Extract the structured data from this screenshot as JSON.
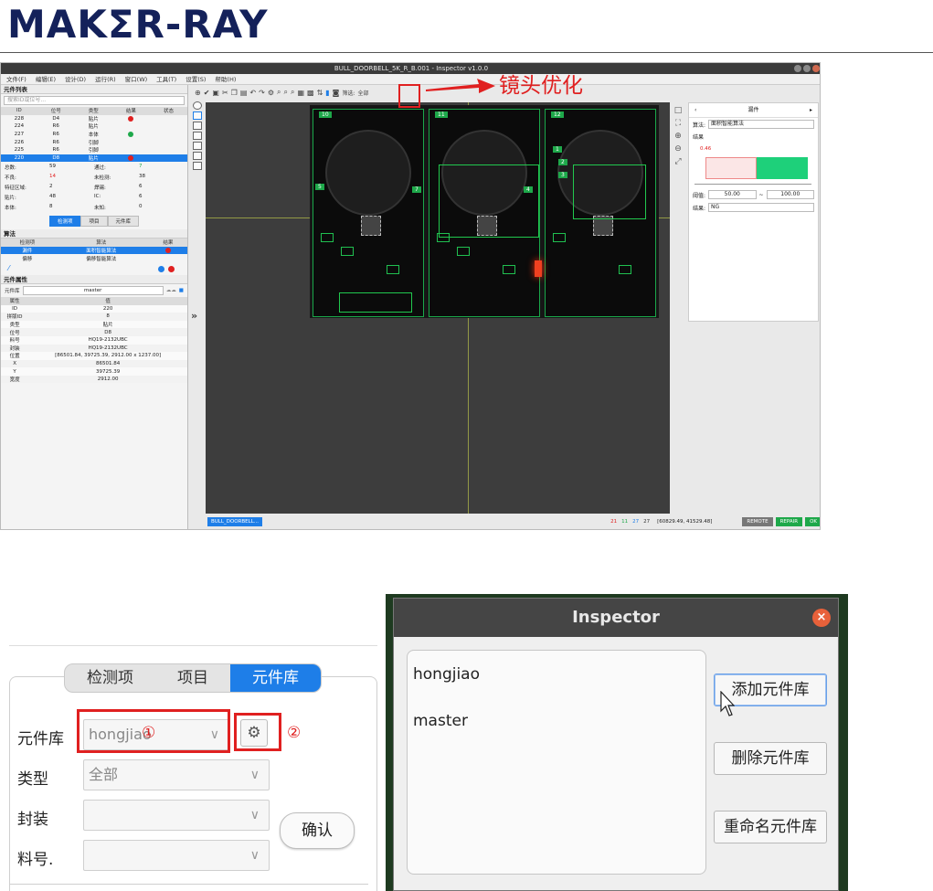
{
  "brand": {
    "logo_text": "MAKΣR-RAY"
  },
  "app": {
    "window_title": "BULL_DOORBELL_5K_R_B.001 - Inspector v1.0.0",
    "menu": [
      "文件(F)",
      "编辑(E)",
      "设计(D)",
      "运行(R)",
      "窗口(W)",
      "工具(T)",
      "设置(S)",
      "帮助(H)"
    ],
    "left_panel": {
      "title": "元件列表",
      "search_placeholder": "搜索ID或位号...",
      "columns": [
        "ID",
        "位号",
        "类型",
        "结果",
        "状态"
      ],
      "rows": [
        {
          "id": "228",
          "ref": "D4",
          "type": "贴片",
          "result": "red"
        },
        {
          "id": "224",
          "ref": "R6",
          "type": "贴片",
          "result": ""
        },
        {
          "id": "227",
          "ref": "R6",
          "type": "本体",
          "result": "green"
        },
        {
          "id": "226",
          "ref": "R6",
          "type": "引脚",
          "result": ""
        },
        {
          "id": "225",
          "ref": "R6",
          "type": "引脚",
          "result": ""
        },
        {
          "id": "220",
          "ref": "D8",
          "type": "贴片",
          "result": "red",
          "selected": true
        }
      ],
      "stats": [
        {
          "k": "总数:",
          "v": "59"
        },
        {
          "k": "通过:",
          "v": "7"
        },
        {
          "k": "不良:",
          "v": "14"
        },
        {
          "k": "未检测:",
          "v": "38"
        },
        {
          "k": "特征区域:",
          "v": "2"
        },
        {
          "k": "焊锡:",
          "v": "6"
        },
        {
          "k": "贴片:",
          "v": "48"
        },
        {
          "k": "IC:",
          "v": "6"
        },
        {
          "k": "本体:",
          "v": "8"
        },
        {
          "k": "未知:",
          "v": "0"
        }
      ],
      "tabs": [
        "检测项",
        "项目",
        "元件库"
      ],
      "algo_title": "算法",
      "algo_columns": [
        "检测项",
        "算法",
        "结果"
      ],
      "algo_rows": [
        {
          "item": "漏件",
          "algo": "面积智能算法",
          "result": "red",
          "selected": true
        },
        {
          "item": "偏移",
          "algo": "偏移智能算法",
          "result": ""
        }
      ],
      "props_title": "元件属性",
      "lib_label": "元件库",
      "lib_value": "master",
      "props_columns": [
        "属性",
        "值"
      ],
      "props_rows": [
        [
          "ID",
          "220"
        ],
        [
          "拼版ID",
          "8"
        ],
        [
          "类型",
          "贴片"
        ],
        [
          "位号",
          "D8"
        ],
        [
          "料号",
          "HQ19-2132UBC"
        ],
        [
          "封装",
          "HQ19-2132UBC"
        ],
        [
          "位置",
          "[86501.84, 39725.39, 2912.00 x 1237.00]"
        ],
        [
          "X",
          "86501.84"
        ],
        [
          "Y",
          "39725.39"
        ],
        [
          "宽度",
          "2912.00"
        ]
      ]
    },
    "toolbar": {
      "filter_label": "筛选:",
      "filter_value": "全部"
    },
    "board_labels": [
      "10",
      "11",
      "12",
      "5",
      "7",
      "4",
      "1",
      "2",
      "3"
    ],
    "status": {
      "tab": "BULL_DOORBELL...",
      "counts": [
        {
          "v": "21",
          "c": "#e02020"
        },
        {
          "v": "11",
          "c": "#1ea84a"
        },
        {
          "v": "27",
          "c": "#1e7ee8"
        },
        {
          "v": "27",
          "c": "#333333"
        }
      ],
      "coords": "[60829.49, 41529.48]",
      "buttons": [
        "REMOTE",
        "REPAIR",
        "OK"
      ]
    },
    "right_panel": {
      "title": "漏件",
      "algo_label": "算法:",
      "algo_value": "面积智能算法",
      "result_label": "结果",
      "chart_value": "0.46",
      "threshold_label": "阈值:",
      "threshold_min": "50.00",
      "threshold_sep": "~",
      "threshold_max": "100.00",
      "result2_label": "结果:",
      "result2_value": "NG"
    },
    "annotation": "镜头优化"
  },
  "crop_left": {
    "tabs": [
      "检测项",
      "项目",
      "元件库"
    ],
    "active_tab": 2,
    "fields": [
      {
        "label": "元件库",
        "value": "hongjiao"
      },
      {
        "label": "类型",
        "value": "全部"
      },
      {
        "label": "封装",
        "value": ""
      },
      {
        "label": "料号.",
        "value": ""
      }
    ],
    "confirm_label": "确认",
    "marker1": "①",
    "marker2": "②"
  },
  "dialog": {
    "title": "Inspector",
    "close_glyph": "×",
    "items": [
      "hongjiao",
      "master"
    ],
    "buttons": [
      "添加元件库",
      "删除元件库",
      "重命名元件库"
    ]
  },
  "colors": {
    "accent": "#1e7ee8",
    "annotation": "#e02020",
    "ok": "#1ea84a",
    "pcb_bg": "#0b0b0b"
  }
}
